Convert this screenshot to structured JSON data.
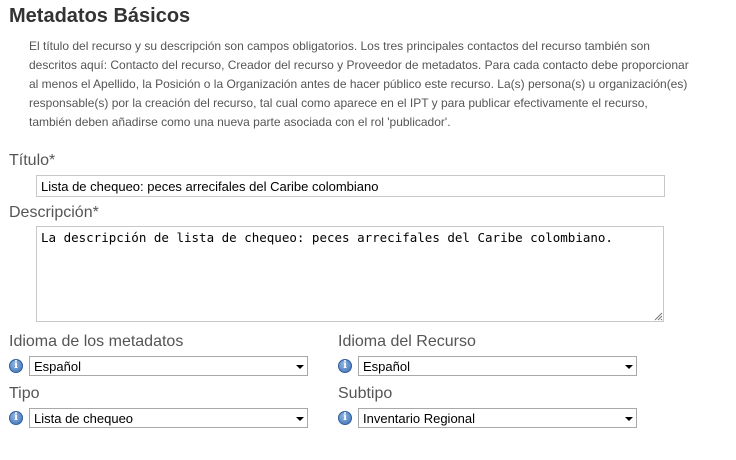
{
  "section": {
    "title": "Metadatos Básicos",
    "intro": "El título del recurso y su descripción son campos obligatorios. Los tres principales contactos del recurso también son descritos aquí: Contacto del recurso, Creador del recurso y Proveedor de metadatos. Para cada contacto debe proporcionar al menos el Apellido, la Posición o la Organización antes de hacer público este recurso. La(s) persona(s) u organización(es) responsable(s) por la creación del recurso, tal cual como aparece en el IPT y para publicar efectivamente el recurso, también deben añadirse como una nueva parte asociada con el rol 'publicador'."
  },
  "fields": {
    "titulo": {
      "label": "Título*",
      "value": "Lista de chequeo: peces arrecifales del Caribe colombiano"
    },
    "descripcion": {
      "label": "Descripción*",
      "value": "La descripción de lista de chequeo: peces arrecifales del Caribe colombiano."
    },
    "idioma_metadatos": {
      "label": "Idioma de los metadatos",
      "value": "Español"
    },
    "idioma_recurso": {
      "label": "Idioma del Recurso",
      "value": "Español"
    },
    "tipo": {
      "label": "Tipo",
      "value": "Lista de chequeo"
    },
    "subtipo": {
      "label": "Subtipo",
      "value": "Inventario Regional"
    }
  },
  "icons": {
    "info": "info-icon",
    "dropdown": "chevron-down-icon",
    "resize": "resize-grip-icon"
  }
}
